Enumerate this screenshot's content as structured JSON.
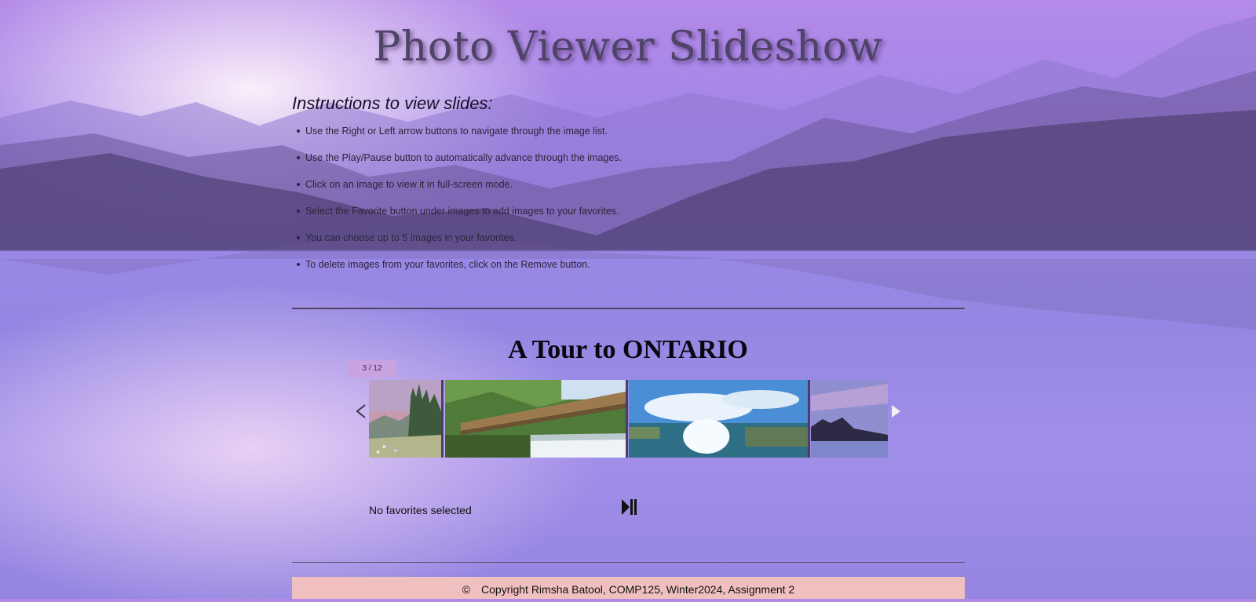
{
  "header": {
    "title": "Photo Viewer Slideshow"
  },
  "instructions": {
    "title": "Instructions to view slides:",
    "items": [
      "Use the Right or Left arrow buttons to navigate through the image list.",
      "Use the Play/Pause button to automatically advance through the images.",
      "Click on an image to view it in full-screen mode.",
      "Select the Favorite button under images to add images to your favorites.",
      "You can choose up to 5 images in your favorites.",
      "To delete images from your favorites, click on the Remove button."
    ]
  },
  "slideshow": {
    "title": "A Tour to ONTARIO",
    "counter": "3 / 12",
    "prev_icon": "chevron-left-icon",
    "next_icon": "chevron-right-icon",
    "play_pause_icon": "play-pause-icon",
    "favorites_text": "No favorites selected",
    "slides": [
      "forest-meadow",
      "boardwalk-waterfall",
      "niagara-falls",
      "lake-cliff-dusk"
    ]
  },
  "footer": {
    "copyright_symbol": "©",
    "text": "Copyright Rimsha Batool, COMP125, Winter2024, Assignment 2"
  },
  "colors": {
    "accent": "#efc0bf",
    "counter_bg": "#c9a3e0",
    "title": "#4e4468"
  }
}
